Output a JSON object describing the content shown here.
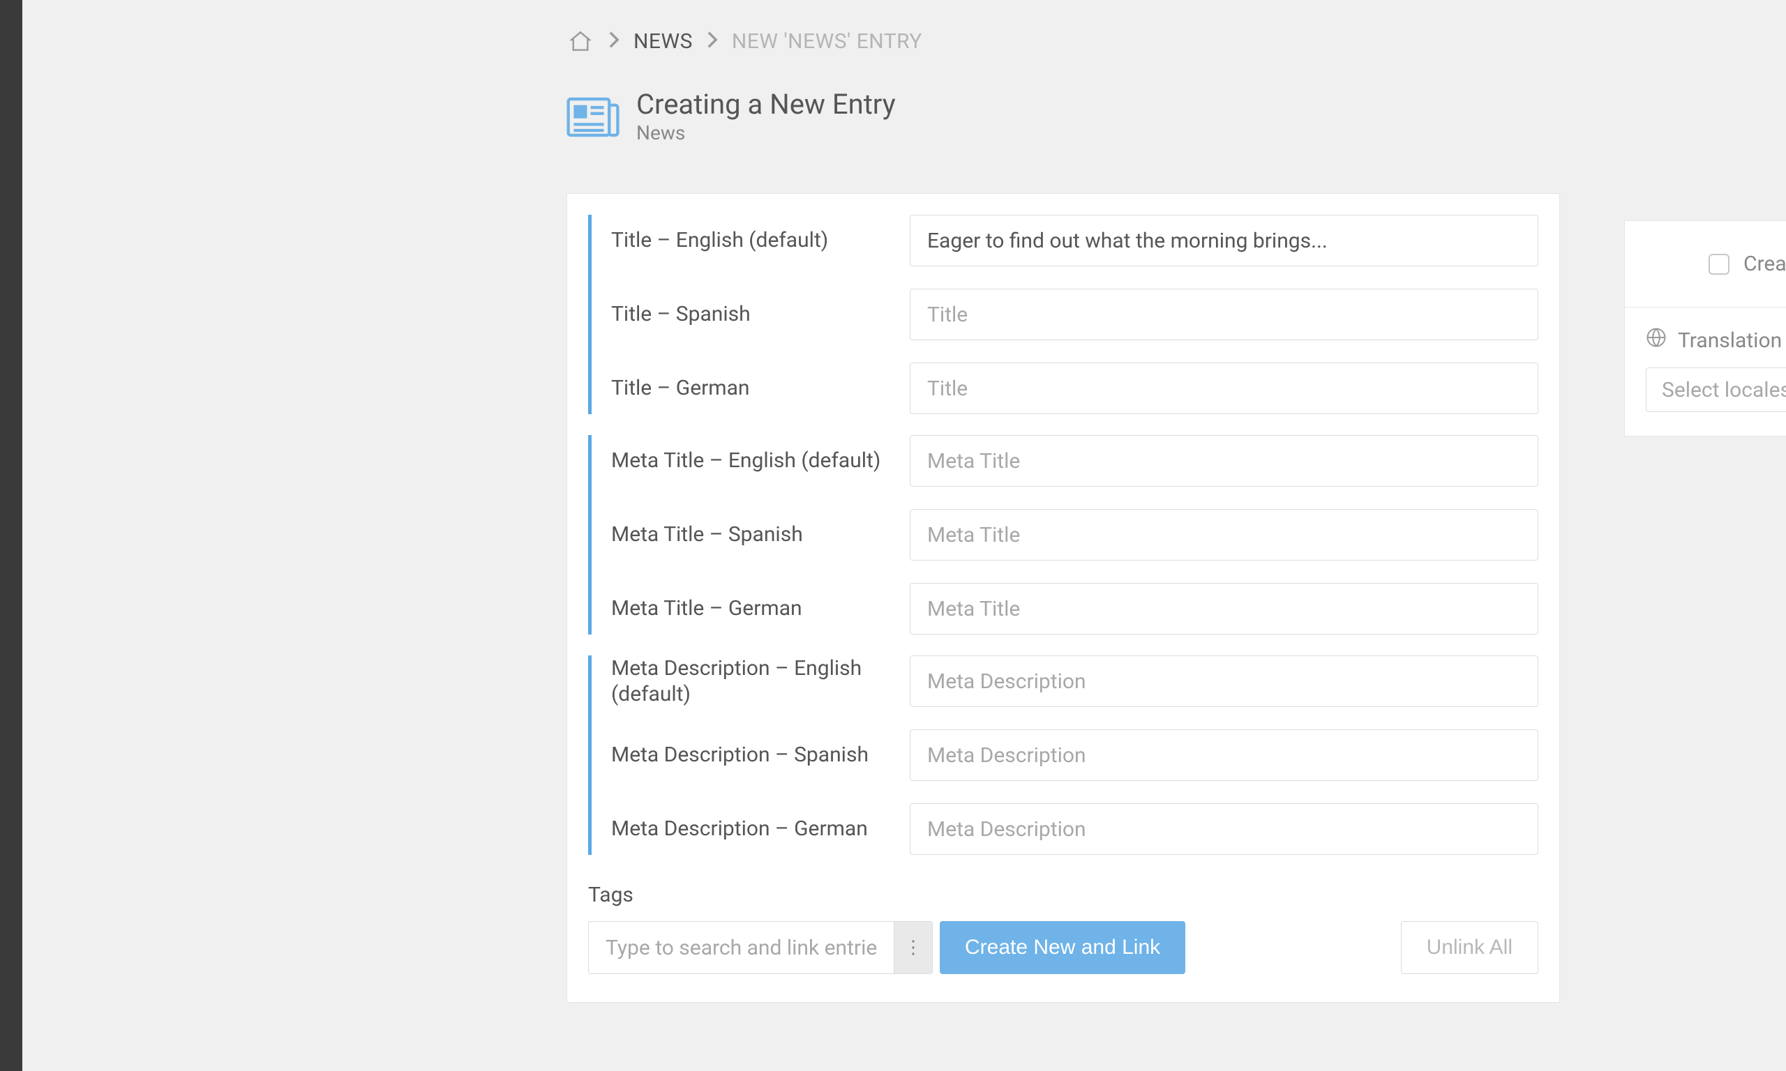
{
  "breadcrumb": {
    "home_aria": "Home",
    "items": [
      {
        "label": "NEWS"
      },
      {
        "label": "NEW 'NEWS' ENTRY"
      }
    ]
  },
  "heading": {
    "title": "Creating a New Entry",
    "subtitle": "News"
  },
  "field_groups": [
    {
      "rows": [
        {
          "label": "Title – English (default)",
          "placeholder": "Title",
          "value": "Eager to find out what the morning brings..."
        },
        {
          "label": "Title – Spanish",
          "placeholder": "Title",
          "value": ""
        },
        {
          "label": "Title – German",
          "placeholder": "Title",
          "value": ""
        }
      ]
    },
    {
      "rows": [
        {
          "label": "Meta Title – English (default)",
          "placeholder": "Meta Title",
          "value": ""
        },
        {
          "label": "Meta Title – Spanish",
          "placeholder": "Meta Title",
          "value": ""
        },
        {
          "label": "Meta Title – German",
          "placeholder": "Meta Title",
          "value": ""
        }
      ]
    },
    {
      "rows": [
        {
          "label": "Meta Description – English (default)",
          "placeholder": "Meta Description",
          "value": ""
        },
        {
          "label": "Meta Description – Spanish",
          "placeholder": "Meta Description",
          "value": ""
        },
        {
          "label": "Meta Description – German",
          "placeholder": "Meta Description",
          "value": ""
        }
      ]
    }
  ],
  "tags": {
    "label": "Tags",
    "search_placeholder": "Type to search and link entries",
    "create_label": "Create New and Link",
    "unlink_label": "Unlink All"
  },
  "side": {
    "create_label": "Create",
    "translation_label": "Translation",
    "select_placeholder": "Select locales to f"
  }
}
